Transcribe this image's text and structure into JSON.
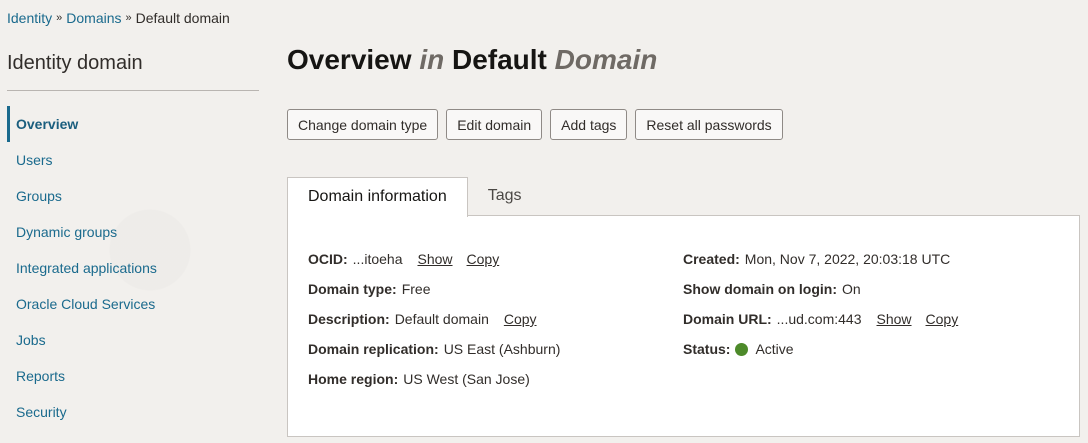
{
  "breadcrumb": {
    "items": [
      "Identity",
      "Domains",
      "Default domain"
    ],
    "separator": "»"
  },
  "sidebar": {
    "title": "Identity domain",
    "items": [
      {
        "label": "Overview",
        "active": true
      },
      {
        "label": "Users"
      },
      {
        "label": "Groups"
      },
      {
        "label": "Dynamic groups"
      },
      {
        "label": "Integrated applications"
      },
      {
        "label": "Oracle Cloud Services"
      },
      {
        "label": "Jobs"
      },
      {
        "label": "Reports"
      },
      {
        "label": "Security"
      }
    ]
  },
  "header": {
    "title_part1": "Overview",
    "title_part2": "in",
    "title_part3": "Default",
    "title_part4": "Domain"
  },
  "actions": {
    "change_type": "Change domain type",
    "edit": "Edit domain",
    "add_tags": "Add tags",
    "reset_passwords": "Reset all passwords"
  },
  "tabs": {
    "domain_info": "Domain information",
    "tags": "Tags"
  },
  "info": {
    "ocid_label": "OCID:",
    "ocid_value": "...itoeha",
    "show": "Show",
    "copy": "Copy",
    "domain_type_label": "Domain type:",
    "domain_type_value": "Free",
    "description_label": "Description:",
    "description_value": "Default domain",
    "replication_label": "Domain replication:",
    "replication_value": "US East (Ashburn)",
    "home_region_label": "Home region:",
    "home_region_value": "US West (San Jose)",
    "created_label": "Created:",
    "created_value": "Mon, Nov 7, 2022, 20:03:18 UTC",
    "show_login_label": "Show domain on login:",
    "show_login_value": "On",
    "url_label": "Domain URL:",
    "url_value": "...ud.com:443",
    "status_label": "Status:",
    "status_value": "Active",
    "status_color": "#4d8a2a"
  },
  "colors": {
    "link": "#1a6a8d",
    "background": "#f2f0ed"
  }
}
